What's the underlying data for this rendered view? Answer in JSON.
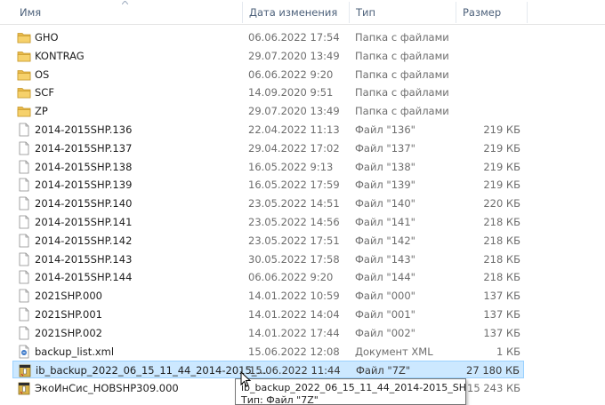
{
  "columns": {
    "name": "Имя",
    "date": "Дата изменения",
    "type": "Тип",
    "size": "Размер"
  },
  "files": [
    {
      "icon": "folder-icon",
      "name": "GHO",
      "date": "06.06.2022 17:54",
      "type": "Папка с файлами",
      "size": ""
    },
    {
      "icon": "folder-icon",
      "name": "KONTRAG",
      "date": "29.07.2020 13:49",
      "type": "Папка с файлами",
      "size": ""
    },
    {
      "icon": "folder-icon",
      "name": "OS",
      "date": "06.06.2022 9:20",
      "type": "Папка с файлами",
      "size": ""
    },
    {
      "icon": "folder-icon",
      "name": "SCF",
      "date": "14.09.2020 9:51",
      "type": "Папка с файлами",
      "size": ""
    },
    {
      "icon": "folder-icon",
      "name": "ZP",
      "date": "29.07.2020 13:49",
      "type": "Папка с файлами",
      "size": ""
    },
    {
      "icon": "file-icon",
      "name": "2014-2015SHP.136",
      "date": "22.04.2022 11:13",
      "type": "Файл \"136\"",
      "size": "219 КБ"
    },
    {
      "icon": "file-icon",
      "name": "2014-2015SHP.137",
      "date": "29.04.2022 17:02",
      "type": "Файл \"137\"",
      "size": "219 КБ"
    },
    {
      "icon": "file-icon",
      "name": "2014-2015SHP.138",
      "date": "16.05.2022 9:13",
      "type": "Файл \"138\"",
      "size": "219 КБ"
    },
    {
      "icon": "file-icon",
      "name": "2014-2015SHP.139",
      "date": "16.05.2022 17:59",
      "type": "Файл \"139\"",
      "size": "219 КБ"
    },
    {
      "icon": "file-icon",
      "name": "2014-2015SHP.140",
      "date": "23.05.2022 14:51",
      "type": "Файл \"140\"",
      "size": "220 КБ"
    },
    {
      "icon": "file-icon",
      "name": "2014-2015SHP.141",
      "date": "23.05.2022 14:56",
      "type": "Файл \"141\"",
      "size": "218 КБ"
    },
    {
      "icon": "file-icon",
      "name": "2014-2015SHP.142",
      "date": "23.05.2022 17:51",
      "type": "Файл \"142\"",
      "size": "218 КБ"
    },
    {
      "icon": "file-icon",
      "name": "2014-2015SHP.143",
      "date": "30.05.2022 17:58",
      "type": "Файл \"143\"",
      "size": "218 КБ"
    },
    {
      "icon": "file-icon",
      "name": "2014-2015SHP.144",
      "date": "06.06.2022 9:20",
      "type": "Файл \"144\"",
      "size": "218 КБ"
    },
    {
      "icon": "file-icon",
      "name": "2021SHP.000",
      "date": "14.01.2022 10:59",
      "type": "Файл \"000\"",
      "size": "137 КБ"
    },
    {
      "icon": "file-icon",
      "name": "2021SHP.001",
      "date": "14.01.2022 14:04",
      "type": "Файл \"001\"",
      "size": "137 КБ"
    },
    {
      "icon": "file-icon",
      "name": "2021SHP.002",
      "date": "14.01.2022 17:44",
      "type": "Файл \"002\"",
      "size": "137 КБ"
    },
    {
      "icon": "xml-file-icon",
      "name": "backup_list.xml",
      "date": "15.06.2022 12:08",
      "type": "Документ XML",
      "size": "1 КБ"
    },
    {
      "icon": "archive-7z-icon",
      "name": "ib_backup_2022_06_15_11_44_2014-2015_...",
      "date": "15.06.2022 11:44",
      "type": "Файл \"7Z\"",
      "size": "27 180 КБ",
      "selected": true
    },
    {
      "icon": "archive-7z-icon",
      "name": "ЭкоИнСис_НОВSHP309.000",
      "date": "",
      "type": "",
      "size": "15 243 КБ"
    }
  ],
  "tooltip": {
    "line1": "ib_backup_2022_06_15_11_44_2014-2015_SHP.7z",
    "line2": "Тип: Файл \"7Z\""
  },
  "colors": {
    "selection_bg": "#cce8ff",
    "selection_border": "#99d1ff",
    "folder": "#e8b94a",
    "header_text": "#4c607a"
  }
}
